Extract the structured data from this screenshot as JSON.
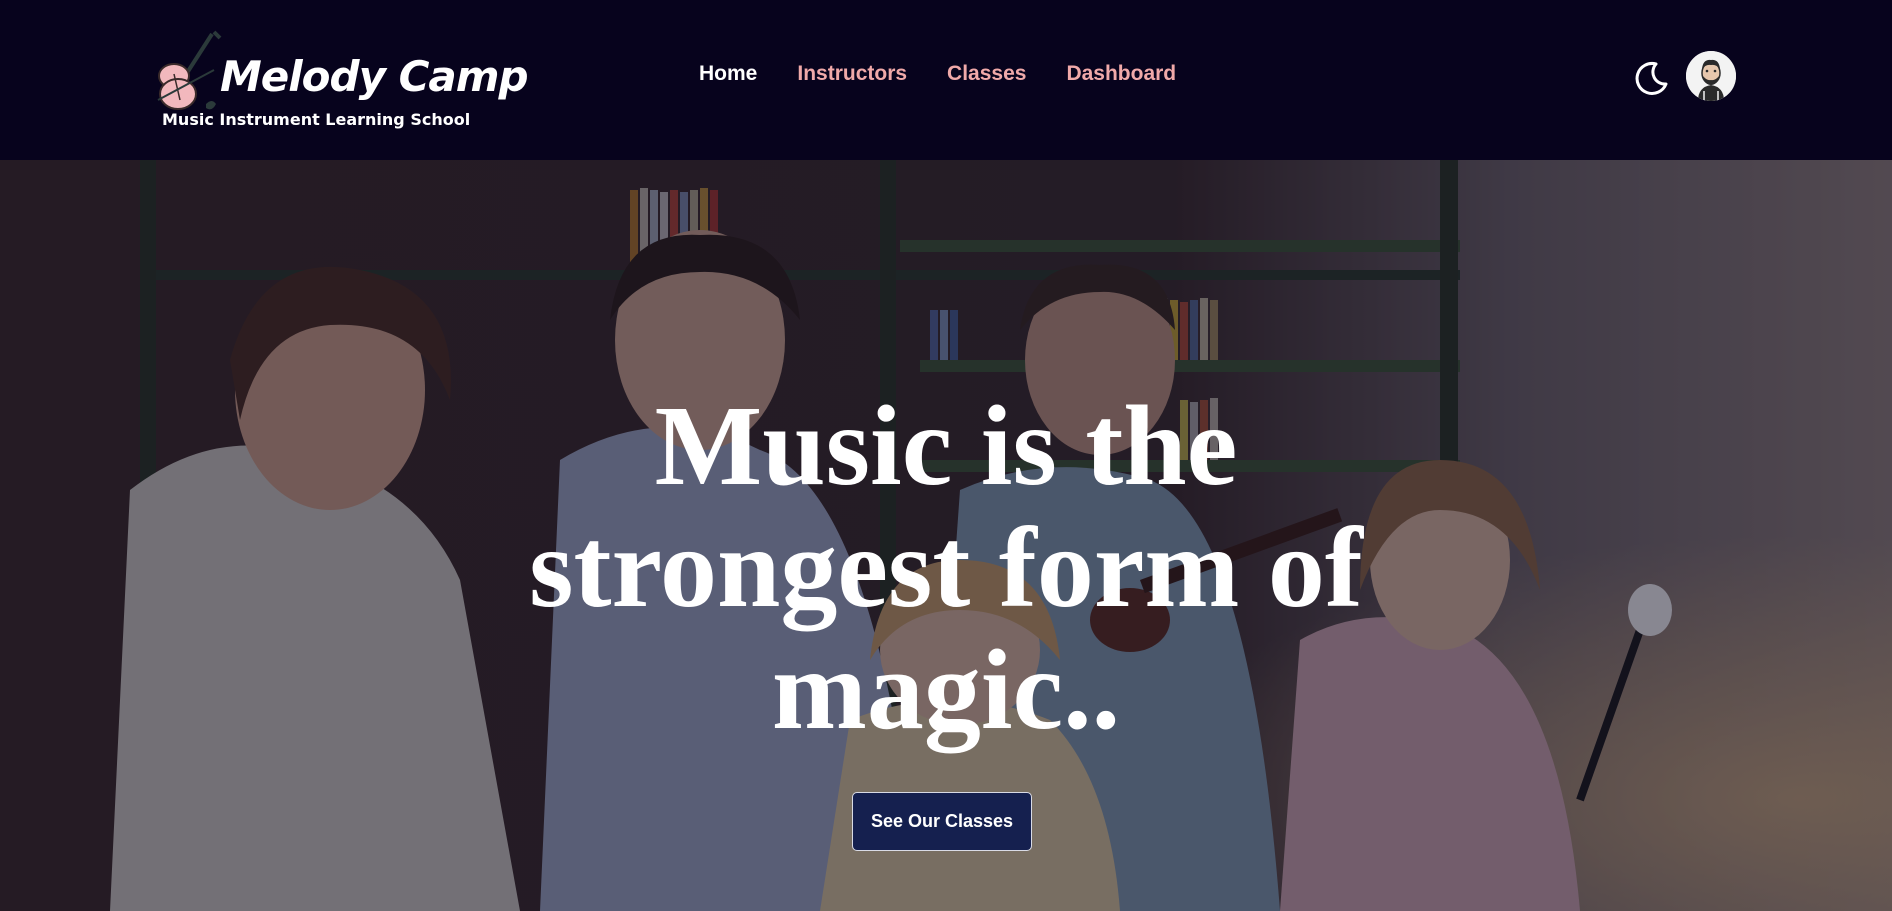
{
  "brand": {
    "name": "Melody Camp",
    "tagline": "Music Instrument Learning School"
  },
  "nav": {
    "items": [
      {
        "label": "Home",
        "active": true
      },
      {
        "label": "Instructors",
        "active": false
      },
      {
        "label": "Classes",
        "active": false
      },
      {
        "label": "Dashboard",
        "active": false
      }
    ]
  },
  "header_actions": {
    "theme_icon": "moon-icon",
    "avatar_icon": "user-avatar"
  },
  "hero": {
    "title": "Music is the strongest form of magic..",
    "cta_label": "See Our Classes"
  },
  "colors": {
    "navbar_bg": "#07031d",
    "nav_link": "#f0a9a9",
    "nav_active": "#ffffff",
    "cta_bg": "#15204f"
  }
}
